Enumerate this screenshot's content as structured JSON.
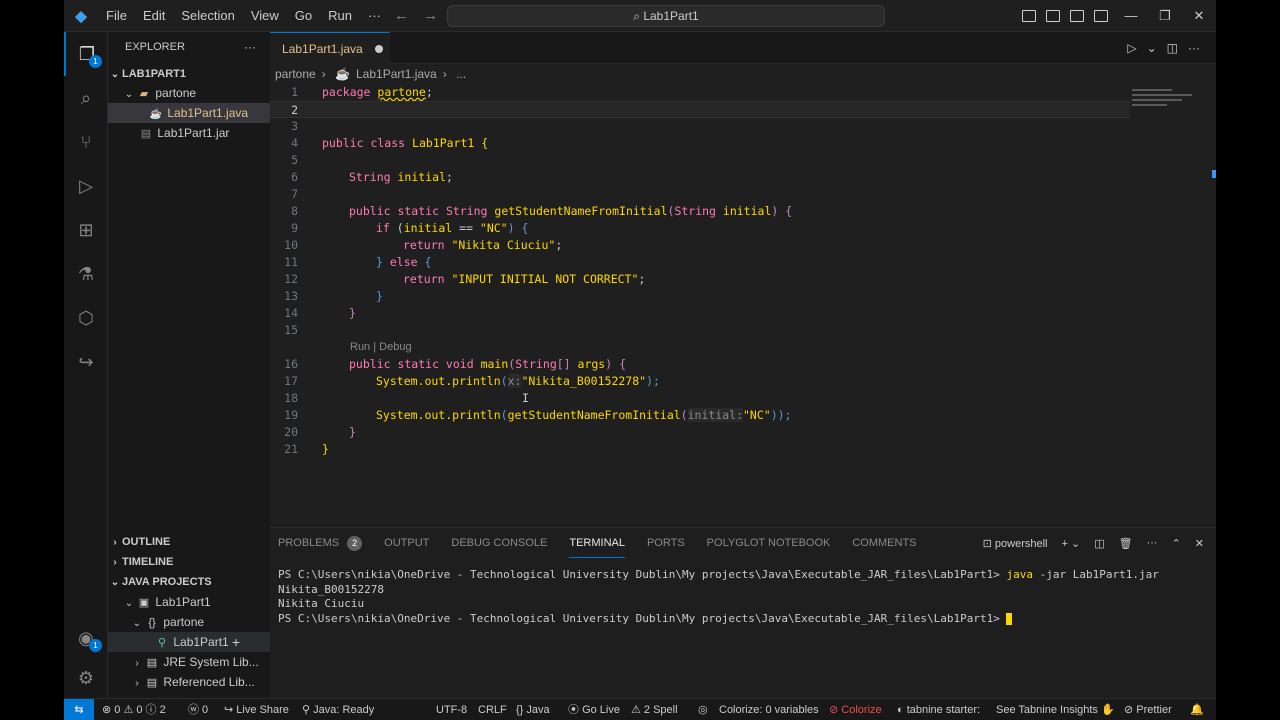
{
  "menu": [
    "File",
    "Edit",
    "Selection",
    "View",
    "Go",
    "Run",
    "···"
  ],
  "search": {
    "text": "Lab1Part1"
  },
  "sidebar": {
    "title": "EXPLORER",
    "project": "LAB1PART1",
    "folder": "partone",
    "file_java": "Lab1Part1.java",
    "file_jar": "Lab1Part1.jar",
    "outline": "OUTLINE",
    "timeline": "TIMELINE",
    "java_projects": "JAVA PROJECTS",
    "jp_project": "Lab1Part1",
    "jp_package": "partone",
    "jp_class": "Lab1Part1",
    "jre": "JRE System Lib...",
    "referenced": "Referenced Lib..."
  },
  "tab": {
    "label": "Lab1Part1.java"
  },
  "breadcrumb": {
    "folder": "partone",
    "file": "Lab1Part1.java",
    "more": "..."
  },
  "codelens": "Run | Debug",
  "code_lines": [
    "1",
    "2",
    "3",
    "4",
    "5",
    "6",
    "7",
    "8",
    "9",
    "10",
    "11",
    "12",
    "13",
    "14",
    "15",
    "16",
    "17",
    "18",
    "19",
    "20",
    "21"
  ],
  "code": {
    "l1a": "package ",
    "l1b": "partone",
    "l1c": ";",
    "l4a": "public class ",
    "l4b": "Lab1Part1",
    "l4c": " {",
    "l6a": "String ",
    "l6b": "initial",
    "l6c": ";",
    "l8a": "public static ",
    "l8b": "String ",
    "l8c": "getStudentNameFromInitial",
    "l8d": "(",
    "l8e": "String ",
    "l8f": "initial",
    "l8g": ") {",
    "l9a": "if ",
    "l9b": "(",
    "l9c": "initial",
    "l9d": " == ",
    "l9e": "\"NC\"",
    "l9f": ") {",
    "l10a": "return ",
    "l10b": "\"Nikita Ciuciu\"",
    "l10c": ";",
    "l11a": "} ",
    "l11b": "else",
    "l11c": " {",
    "l12a": "return ",
    "l12b": "\"INPUT INITIAL NOT CORRECT\"",
    "l12c": ";",
    "l13": "}",
    "l14": "}",
    "l16a": "public static void ",
    "l16b": "main",
    "l16c": "(",
    "l16d": "String",
    "l16e": "[] ",
    "l16f": "args",
    "l16g": ") {",
    "l17a": "System.out.",
    "l17b": "println",
    "l17c": "(",
    "l17d": "x:",
    "l17e": "\"Nikita_B00152278\"",
    "l17f": ");",
    "l19a": "System.out.",
    "l19b": "println",
    "l19c": "(",
    "l19d": "getStudentNameFromInitial",
    "l19e": "(",
    "l19f": "initial:",
    "l19g": "\"NC\"",
    "l19h": "));",
    "l20": "}",
    "l21": "}"
  },
  "panel": {
    "tabs": [
      "PROBLEMS",
      "OUTPUT",
      "DEBUG CONSOLE",
      "TERMINAL",
      "PORTS",
      "POLYGLOT NOTEBOOK",
      "COMMENTS"
    ],
    "problems_count": "2",
    "shell": "powershell"
  },
  "terminal": {
    "prompt1": "PS C:\\Users\\nikia\\OneDrive - Technological University Dublin\\My projects\\Java\\Executable_JAR_files\\Lab1Part1> ",
    "cmd1": "java",
    "cmd1_args": " -jar Lab1Part1.jar",
    "out1": "Nikita_B00152278",
    "out2": "Nikita Ciuciu",
    "prompt2": "PS C:\\Users\\nikia\\OneDrive - Technological University Dublin\\My projects\\Java\\Executable_JAR_files\\Lab1Part1> "
  },
  "status": {
    "problems": "⊗ 0 ⚠ 0 ⓘ 2",
    "ports": "ⓦ 0",
    "liveshare": "Live Share",
    "java": "Java: Ready",
    "encoding": "UTF-8",
    "eol": "CRLF",
    "lang": "{} Java",
    "golive": "Go Live",
    "spell": "⚠ 2 Spell",
    "colorize": "Colorize: 0 variables",
    "colorize2": "Colorize",
    "tabnine": "tabnine starter:",
    "tabnine_insights": "See Tabnine Insights",
    "prettier": "Prettier"
  }
}
